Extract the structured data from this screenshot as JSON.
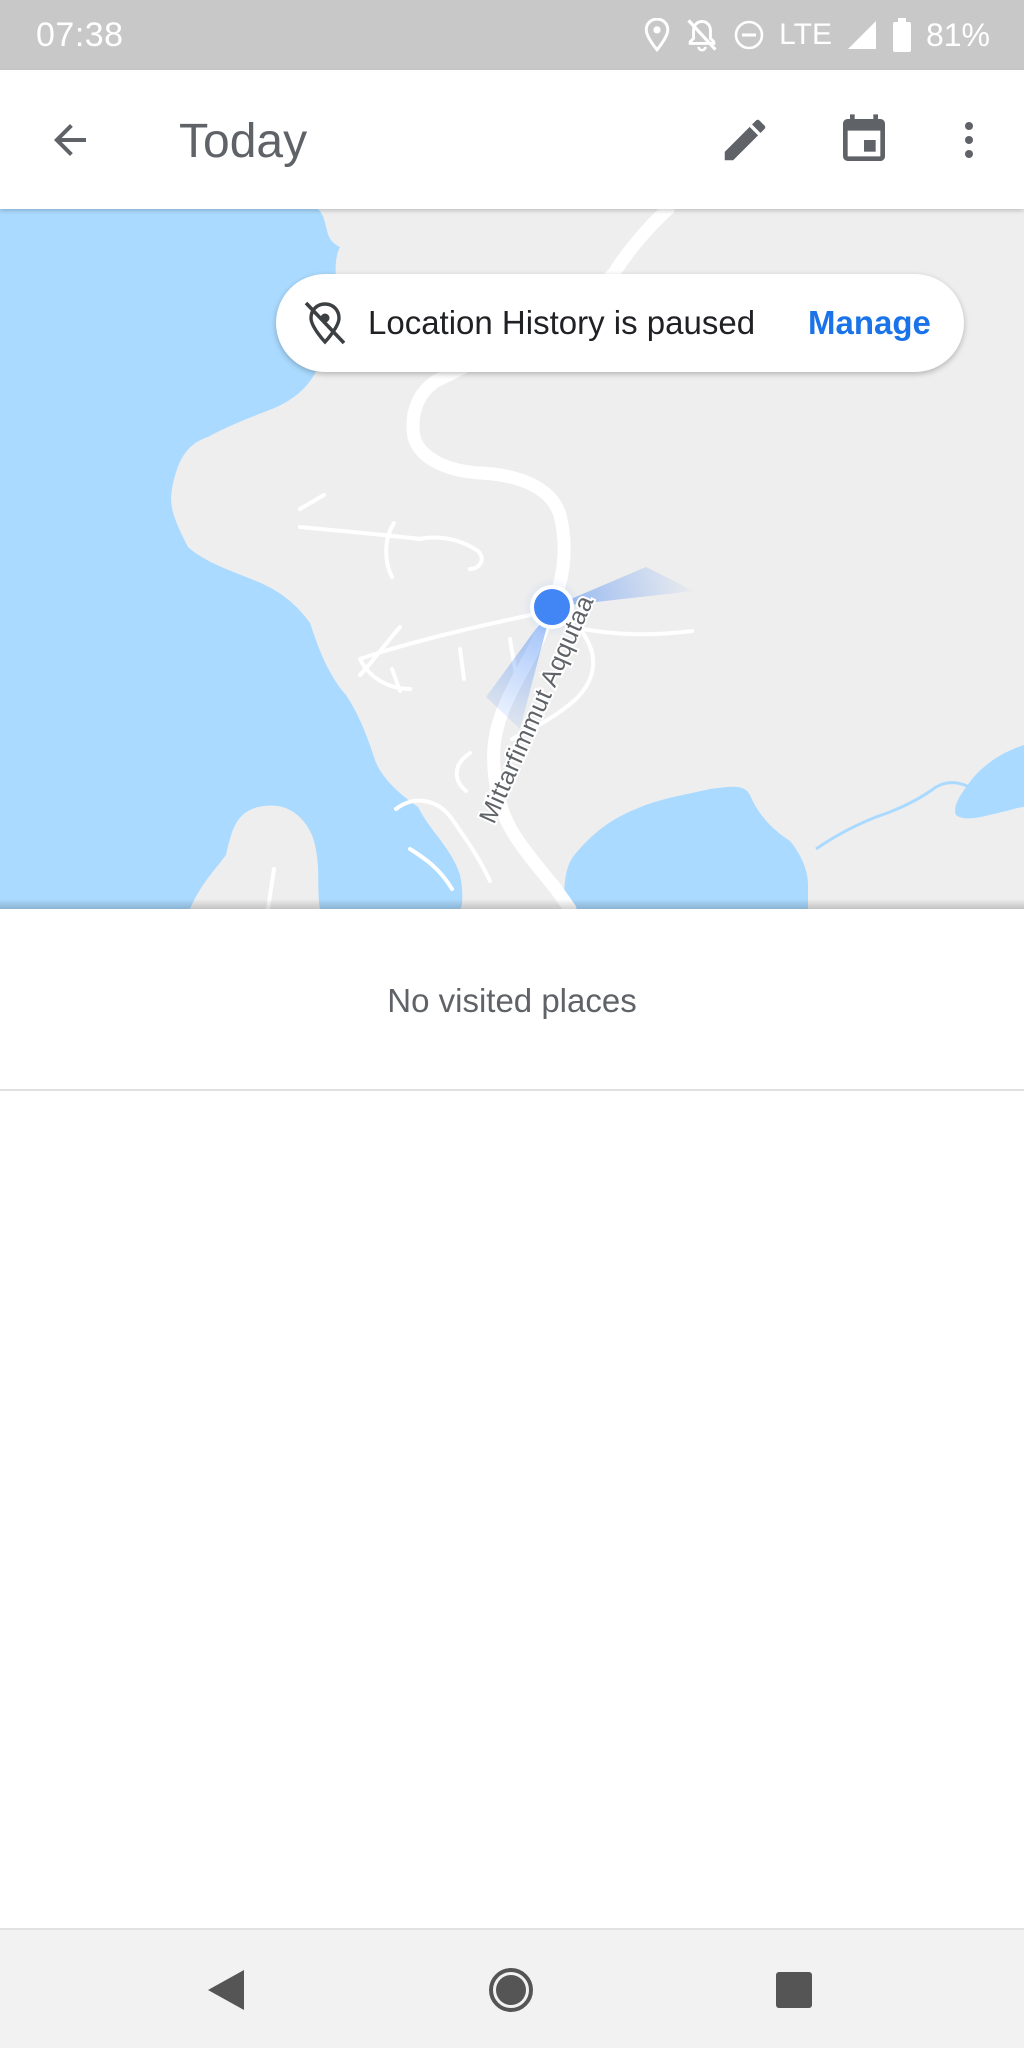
{
  "status_bar": {
    "time": "07:38",
    "network": "LTE",
    "battery": "81%",
    "icons": [
      "location-pin-icon",
      "notifications-off-icon",
      "do-not-disturb-icon",
      "cell-signal-icon",
      "battery-icon"
    ]
  },
  "app_bar": {
    "title": "Today",
    "icons": [
      "back-arrow-icon",
      "pencil-icon",
      "calendar-icon",
      "more-vert-icon"
    ]
  },
  "location_banner": {
    "icon": "location-off-icon",
    "text": "Location History is paused",
    "action": "Manage"
  },
  "map": {
    "road_label": "Mittarfimmut Aqqutaa"
  },
  "content": {
    "empty_message": "No visited places"
  },
  "nav_bar": {
    "icons": [
      "nav-back-icon",
      "nav-home-icon",
      "nav-recents-icon"
    ]
  },
  "colors": {
    "water": "#aadaff",
    "land": "#eeeeee",
    "accent": "#1a73e8",
    "location_dot": "#4285f4"
  }
}
